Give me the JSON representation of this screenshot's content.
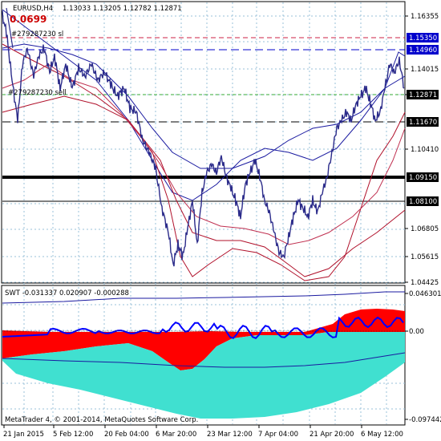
{
  "header": {
    "symbol_timeframe": "EURUSD,H4",
    "ohlc": "1.13033 1.13205 1.12782 1.12871",
    "spread_value": "0.0699",
    "annotation_sl": "#279287230 sl",
    "annotation_sell": "#279287230 sell"
  },
  "price_axis": {
    "labels": [
      "1.16355",
      "1.14015",
      "1.12871",
      "1.10410",
      "1.06805",
      "1.05615",
      "1.04425"
    ]
  },
  "price_tags": [
    {
      "label": "1.15350",
      "bg": "#0000cc",
      "fg": "#ffffff"
    },
    {
      "label": "1.14960",
      "bg": "#0000cc",
      "fg": "#ffffff"
    },
    {
      "label": "1.12871",
      "bg": "#000000",
      "fg": "#ffffff"
    },
    {
      "label": "1.11670",
      "bg": "#000000",
      "fg": "#ffffff"
    },
    {
      "label": "1.09150",
      "bg": "#000000",
      "fg": "#ffffff"
    },
    {
      "label": "1.08100",
      "bg": "#000000",
      "fg": "#ffffff"
    }
  ],
  "indicator": {
    "title": "SWT -0.031337 0.020907 -0.000288",
    "axis_labels": [
      "0.046301",
      "0.00",
      "-0.097442"
    ]
  },
  "footer": {
    "copyright": "MetaTrader 4, © 2001-2014, MetaQuotes Software Corp."
  },
  "time_axis": {
    "labels": [
      "21 Jan 2015",
      "5 Feb 12:00",
      "20 Feb 04:00",
      "6 Mar 20:00",
      "23 Mar 12:00",
      "7 Apr 04:00",
      "21 Apr 20:00",
      "6 May 12:00"
    ]
  },
  "colors": {
    "price_line": "#2b2b8a",
    "bands_blue": "#1a1aa0",
    "bands_red": "#b0102a",
    "hist_red": "#ff0000",
    "hist_cyan": "#40e0d0",
    "signal_blue": "#0000ff",
    "grid": "#9ac0d8"
  }
}
